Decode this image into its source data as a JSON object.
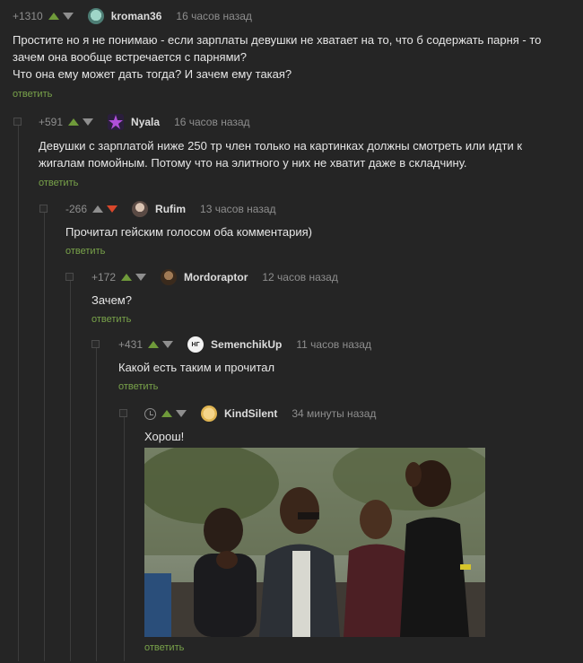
{
  "comments": [
    {
      "rating": "+1310",
      "author": "kroman36",
      "time": "16 часов назад",
      "text": "Простите но я не понимаю - если зарплаты девушки не хватает на то, что б содержать парня - то зачем она вообще встречается с парнями?\nЧто она ему может дать тогда? И зачем ему такая?",
      "reply": "ответить"
    },
    {
      "rating": "+591",
      "author": "Nyala",
      "time": "16 часов назад",
      "text": "Девушки с зарплатой ниже 250 тр член только на картинках должны смотреть или идти к жигалам помойным. Потому что на элитного у них не хватит даже в складчину.",
      "reply": "ответить"
    },
    {
      "rating": "-266",
      "author": "Rufim",
      "time": "13 часов назад",
      "text": "Прочитал гейским голосом оба комментария)",
      "reply": "ответить"
    },
    {
      "rating": "+172",
      "author": "Mordoraptor",
      "time": "12 часов назад",
      "text": "Зачем?",
      "reply": "ответить"
    },
    {
      "rating": "+431",
      "author": "SemenchikUp",
      "time": "11 часов назад",
      "text": "Какой есть таким и прочитал",
      "reply": "ответить"
    },
    {
      "rating": "",
      "author": "KindSilent",
      "time": "34 минуты назад",
      "text": "Хорош!",
      "reply": "ответить"
    }
  ],
  "avatar_badge": "НГ",
  "colors": {
    "background": "#252525",
    "upvote": "#6f9a3a",
    "downvote": "#8e8e8e",
    "downvote_active": "#d9472b",
    "reply_link": "#79a34a"
  }
}
